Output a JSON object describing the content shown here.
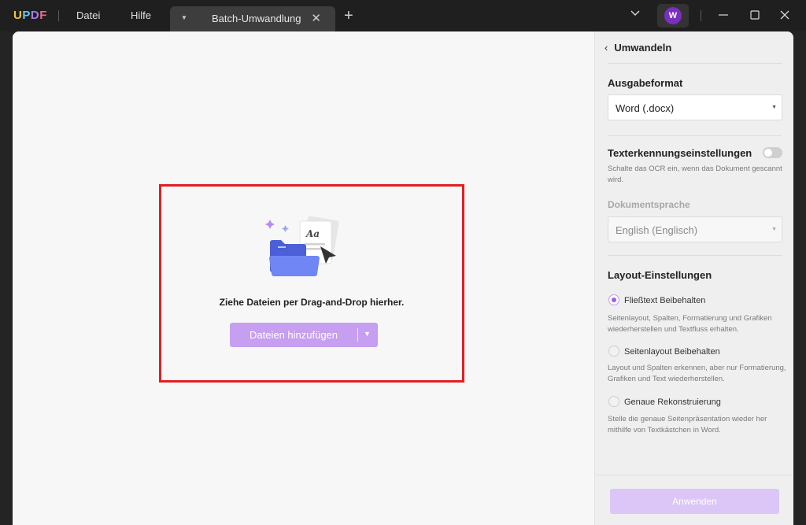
{
  "app": {
    "logo": "UPDF",
    "menu": [
      "Datei",
      "Hilfe"
    ],
    "tab": {
      "title": "Batch-Umwandlung"
    },
    "avatar_letter": "W"
  },
  "main": {
    "drop_text": "Ziehe Dateien per Drag-and-Drop hierher.",
    "add_files_label": "Dateien hinzufügen",
    "illustration_caption": "Aa"
  },
  "panel": {
    "title": "Umwandeln",
    "output_format": {
      "title": "Ausgabeformat",
      "value": "Word (.docx)"
    },
    "ocr": {
      "title": "Texterkennungseinstellungen",
      "enabled": false,
      "help": "Schalte das OCR ein, wenn das Dokument gescannt wird.",
      "language_title": "Dokumentsprache",
      "language_value": "English (Englisch)"
    },
    "layout": {
      "title": "Layout-Einstellungen",
      "options": [
        {
          "label": "Fließtext Beibehalten",
          "help": "Seitenlayout, Spalten, Formatierung und Grafiken wiederherstellen und Textfluss erhalten.",
          "checked": true
        },
        {
          "label": "Seitenlayout Beibehalten",
          "help": "Layout und Spalten erkennen, aber nur Formatierung, Grafiken und Text wiederherstellen.",
          "checked": false
        },
        {
          "label": "Genaue Rekonstruierung",
          "help": "Stelle die genaue Seitenpräsentation wieder her mithilfe von Textkästchen in Word.",
          "checked": false
        }
      ]
    },
    "apply_label": "Anwenden"
  },
  "colors": {
    "accent": "#9b5cf0",
    "button_primary_disabled": "#c69ff1",
    "highlight_border": "#e01e24",
    "titlebar": "#1f1f1f"
  }
}
